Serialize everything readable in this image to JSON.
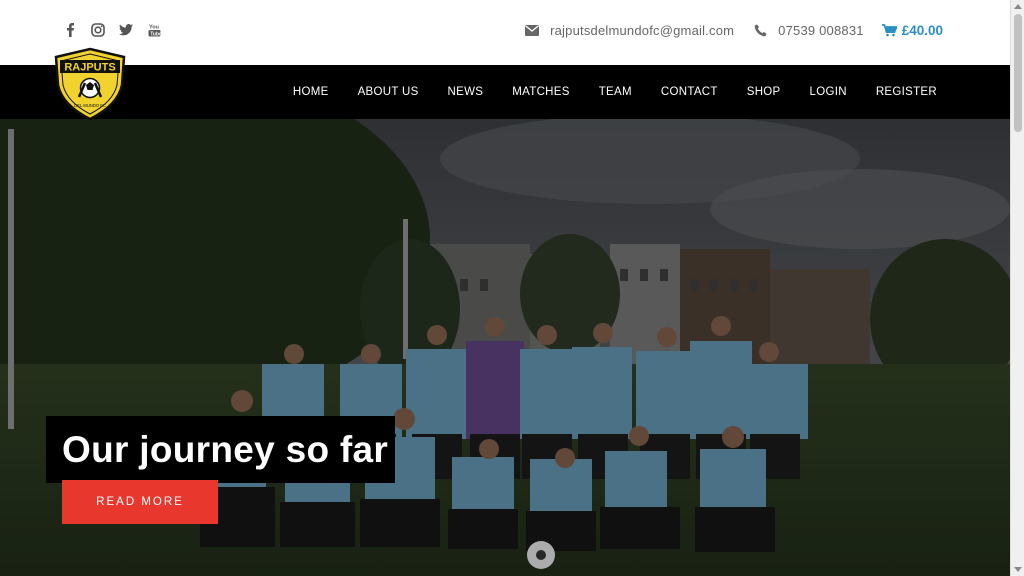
{
  "social": {
    "icons": [
      "facebook-icon",
      "instagram-icon",
      "twitter-icon",
      "youtube-icon"
    ]
  },
  "contact": {
    "email": "rajputsdelmundofc@gmail.com",
    "phone": "07539 008831",
    "cart_total": "£40.00"
  },
  "logo": {
    "text": "RAJPUTS",
    "subtext": "DEL MUNDO FC"
  },
  "nav": {
    "items": [
      "HOME",
      "ABOUT US",
      "NEWS",
      "MATCHES",
      "TEAM",
      "CONTACT",
      "SHOP",
      "LOGIN",
      "REGISTER"
    ]
  },
  "hero": {
    "title": "Our journey so far",
    "button": "READ MORE"
  },
  "colors": {
    "accent": "#e8382e",
    "cart": "#2a8fc6",
    "navbar": "#000000",
    "jersey": "#7fb8d8"
  }
}
